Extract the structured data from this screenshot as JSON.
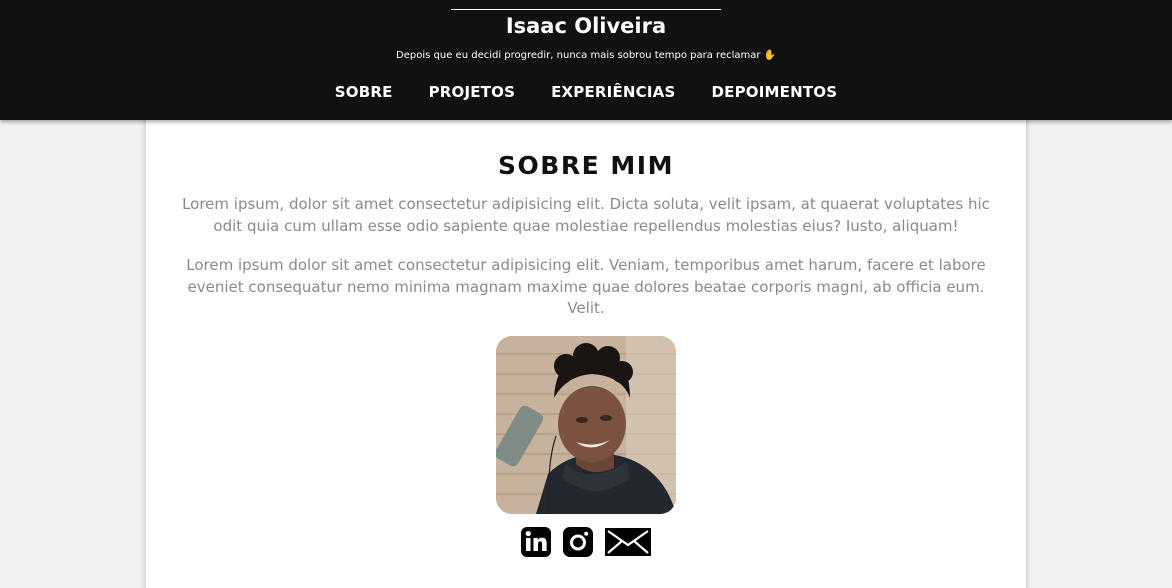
{
  "header": {
    "title": "Isaac Oliveira",
    "tagline": "Depois que eu decidi progredir, nunca mais sobrou tempo para reclamar",
    "tagline_emoji": "✋"
  },
  "nav": {
    "items": [
      {
        "label": "SOBRE"
      },
      {
        "label": "PROJETOS"
      },
      {
        "label": "EXPERIÊNCIAS"
      },
      {
        "label": "DEPOIMENTOS"
      }
    ]
  },
  "about": {
    "title": "SOBRE MIM",
    "paragraphs": [
      "Lorem ipsum, dolor sit amet consectetur adipisicing elit. Dicta soluta, velit ipsam, at quaerat voluptates hic odit quia cum ullam esse odio sapiente quae molestiae repellendus molestias eius? Iusto, aliquam!",
      "Lorem ipsum dolor sit amet consectetur adipisicing elit. Veniam, temporibus amet harum, facere et labore eveniet consequatur nemo minima magnam maxime quae dolores beatae corporis magni, ab officia eum. Velit."
    ]
  },
  "socials": [
    {
      "icon": "linkedin-icon"
    },
    {
      "icon": "instagram-icon"
    },
    {
      "icon": "email-icon"
    }
  ],
  "colors": {
    "header_bg": "#111111",
    "page_bg": "#f2f2f2",
    "card_bg": "#ffffff",
    "paragraph_text": "#8a8a8a"
  }
}
